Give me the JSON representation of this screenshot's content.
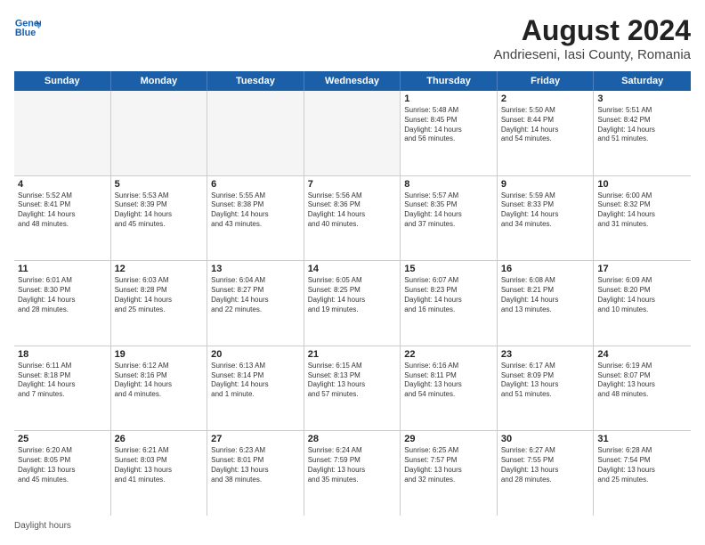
{
  "header": {
    "logo_line1": "General",
    "logo_line2": "Blue",
    "main_title": "August 2024",
    "subtitle": "Andrieseni, Iasi County, Romania"
  },
  "columns": [
    "Sunday",
    "Monday",
    "Tuesday",
    "Wednesday",
    "Thursday",
    "Friday",
    "Saturday"
  ],
  "weeks": [
    [
      {
        "day": "",
        "info": ""
      },
      {
        "day": "",
        "info": ""
      },
      {
        "day": "",
        "info": ""
      },
      {
        "day": "",
        "info": ""
      },
      {
        "day": "1",
        "info": "Sunrise: 5:48 AM\nSunset: 8:45 PM\nDaylight: 14 hours\nand 56 minutes."
      },
      {
        "day": "2",
        "info": "Sunrise: 5:50 AM\nSunset: 8:44 PM\nDaylight: 14 hours\nand 54 minutes."
      },
      {
        "day": "3",
        "info": "Sunrise: 5:51 AM\nSunset: 8:42 PM\nDaylight: 14 hours\nand 51 minutes."
      }
    ],
    [
      {
        "day": "4",
        "info": "Sunrise: 5:52 AM\nSunset: 8:41 PM\nDaylight: 14 hours\nand 48 minutes."
      },
      {
        "day": "5",
        "info": "Sunrise: 5:53 AM\nSunset: 8:39 PM\nDaylight: 14 hours\nand 45 minutes."
      },
      {
        "day": "6",
        "info": "Sunrise: 5:55 AM\nSunset: 8:38 PM\nDaylight: 14 hours\nand 43 minutes."
      },
      {
        "day": "7",
        "info": "Sunrise: 5:56 AM\nSunset: 8:36 PM\nDaylight: 14 hours\nand 40 minutes."
      },
      {
        "day": "8",
        "info": "Sunrise: 5:57 AM\nSunset: 8:35 PM\nDaylight: 14 hours\nand 37 minutes."
      },
      {
        "day": "9",
        "info": "Sunrise: 5:59 AM\nSunset: 8:33 PM\nDaylight: 14 hours\nand 34 minutes."
      },
      {
        "day": "10",
        "info": "Sunrise: 6:00 AM\nSunset: 8:32 PM\nDaylight: 14 hours\nand 31 minutes."
      }
    ],
    [
      {
        "day": "11",
        "info": "Sunrise: 6:01 AM\nSunset: 8:30 PM\nDaylight: 14 hours\nand 28 minutes."
      },
      {
        "day": "12",
        "info": "Sunrise: 6:03 AM\nSunset: 8:28 PM\nDaylight: 14 hours\nand 25 minutes."
      },
      {
        "day": "13",
        "info": "Sunrise: 6:04 AM\nSunset: 8:27 PM\nDaylight: 14 hours\nand 22 minutes."
      },
      {
        "day": "14",
        "info": "Sunrise: 6:05 AM\nSunset: 8:25 PM\nDaylight: 14 hours\nand 19 minutes."
      },
      {
        "day": "15",
        "info": "Sunrise: 6:07 AM\nSunset: 8:23 PM\nDaylight: 14 hours\nand 16 minutes."
      },
      {
        "day": "16",
        "info": "Sunrise: 6:08 AM\nSunset: 8:21 PM\nDaylight: 14 hours\nand 13 minutes."
      },
      {
        "day": "17",
        "info": "Sunrise: 6:09 AM\nSunset: 8:20 PM\nDaylight: 14 hours\nand 10 minutes."
      }
    ],
    [
      {
        "day": "18",
        "info": "Sunrise: 6:11 AM\nSunset: 8:18 PM\nDaylight: 14 hours\nand 7 minutes."
      },
      {
        "day": "19",
        "info": "Sunrise: 6:12 AM\nSunset: 8:16 PM\nDaylight: 14 hours\nand 4 minutes."
      },
      {
        "day": "20",
        "info": "Sunrise: 6:13 AM\nSunset: 8:14 PM\nDaylight: 14 hours\nand 1 minute."
      },
      {
        "day": "21",
        "info": "Sunrise: 6:15 AM\nSunset: 8:13 PM\nDaylight: 13 hours\nand 57 minutes."
      },
      {
        "day": "22",
        "info": "Sunrise: 6:16 AM\nSunset: 8:11 PM\nDaylight: 13 hours\nand 54 minutes."
      },
      {
        "day": "23",
        "info": "Sunrise: 6:17 AM\nSunset: 8:09 PM\nDaylight: 13 hours\nand 51 minutes."
      },
      {
        "day": "24",
        "info": "Sunrise: 6:19 AM\nSunset: 8:07 PM\nDaylight: 13 hours\nand 48 minutes."
      }
    ],
    [
      {
        "day": "25",
        "info": "Sunrise: 6:20 AM\nSunset: 8:05 PM\nDaylight: 13 hours\nand 45 minutes."
      },
      {
        "day": "26",
        "info": "Sunrise: 6:21 AM\nSunset: 8:03 PM\nDaylight: 13 hours\nand 41 minutes."
      },
      {
        "day": "27",
        "info": "Sunrise: 6:23 AM\nSunset: 8:01 PM\nDaylight: 13 hours\nand 38 minutes."
      },
      {
        "day": "28",
        "info": "Sunrise: 6:24 AM\nSunset: 7:59 PM\nDaylight: 13 hours\nand 35 minutes."
      },
      {
        "day": "29",
        "info": "Sunrise: 6:25 AM\nSunset: 7:57 PM\nDaylight: 13 hours\nand 32 minutes."
      },
      {
        "day": "30",
        "info": "Sunrise: 6:27 AM\nSunset: 7:55 PM\nDaylight: 13 hours\nand 28 minutes."
      },
      {
        "day": "31",
        "info": "Sunrise: 6:28 AM\nSunset: 7:54 PM\nDaylight: 13 hours\nand 25 minutes."
      }
    ]
  ],
  "footer": "Daylight hours"
}
